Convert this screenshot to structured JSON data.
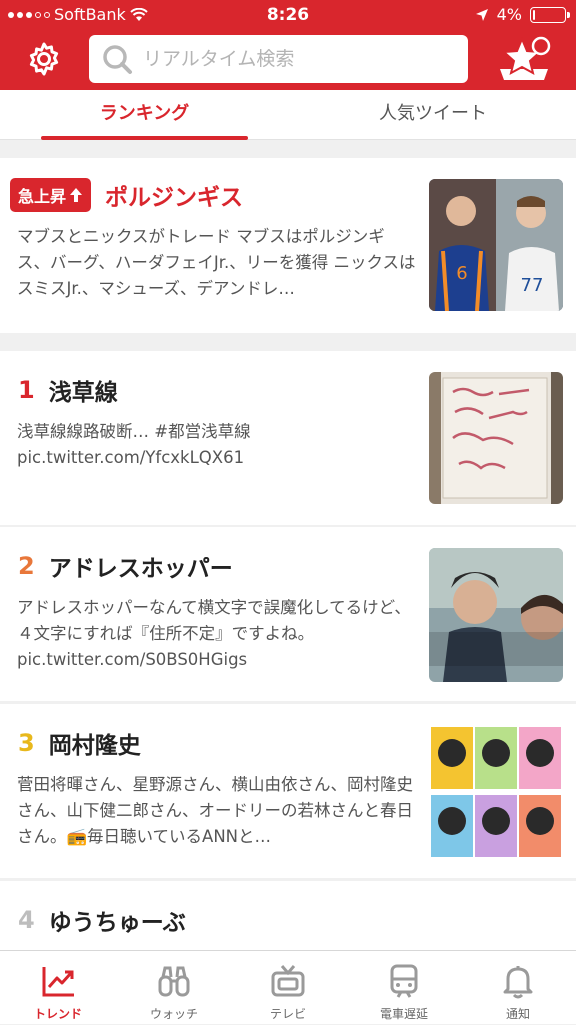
{
  "status_bar": {
    "carrier": "SoftBank",
    "time": "8:26",
    "battery": "4%",
    "battery_level": 0.04
  },
  "header": {
    "settings_icon": "gear-icon",
    "search_placeholder": "リアルタイム検索",
    "star_icon": "star-notification-icon",
    "accent_color": "#d9262d"
  },
  "tabs": [
    {
      "label": "ランキング",
      "active": true
    },
    {
      "label": "人気ツイート",
      "active": false
    }
  ],
  "hot": {
    "badge": "急上昇",
    "title": "ポルジンギス",
    "description": "マブスとニックスがトレード マブスはポルジンギス、バーグ、ハーダフェイJr.、リーを獲得 ニックスはスミスJr.、マシューズ、デアンドレ…"
  },
  "ranking": [
    {
      "rank": "1",
      "title": "浅草線",
      "description": "浅草線線路破断… #都営浅草線 pic.twitter.com/YfcxkLQX61",
      "rank_color": "#d9262d"
    },
    {
      "rank": "2",
      "title": "アドレスホッパー",
      "description": "アドレスホッパーなんて横文字で誤魔化してるけど、４文字にすれば『住所不定』ですよね。pic.twitter.com/S0BS0HGigs",
      "rank_color": "#e8773a"
    },
    {
      "rank": "3",
      "title": "岡村隆史",
      "description": "菅田将暉さん、星野源さん、横山由依さん、岡村隆史さん、山下健二郎さん、オードリーの若林さんと春日さん。📻毎日聴いているANNと…",
      "rank_color": "#e8b81c"
    },
    {
      "rank": "4",
      "title": "ゆうちゅーぶ",
      "description": "",
      "rank_color": "#bdbdbd"
    }
  ],
  "bottom_nav": [
    {
      "label": "トレンド",
      "icon": "trend-chart-icon",
      "active": true
    },
    {
      "label": "ウォッチ",
      "icon": "binoculars-icon",
      "active": false
    },
    {
      "label": "テレビ",
      "icon": "tv-icon",
      "active": false
    },
    {
      "label": "電車遅延",
      "icon": "train-icon",
      "active": false
    },
    {
      "label": "通知",
      "icon": "bell-icon",
      "active": false
    }
  ]
}
